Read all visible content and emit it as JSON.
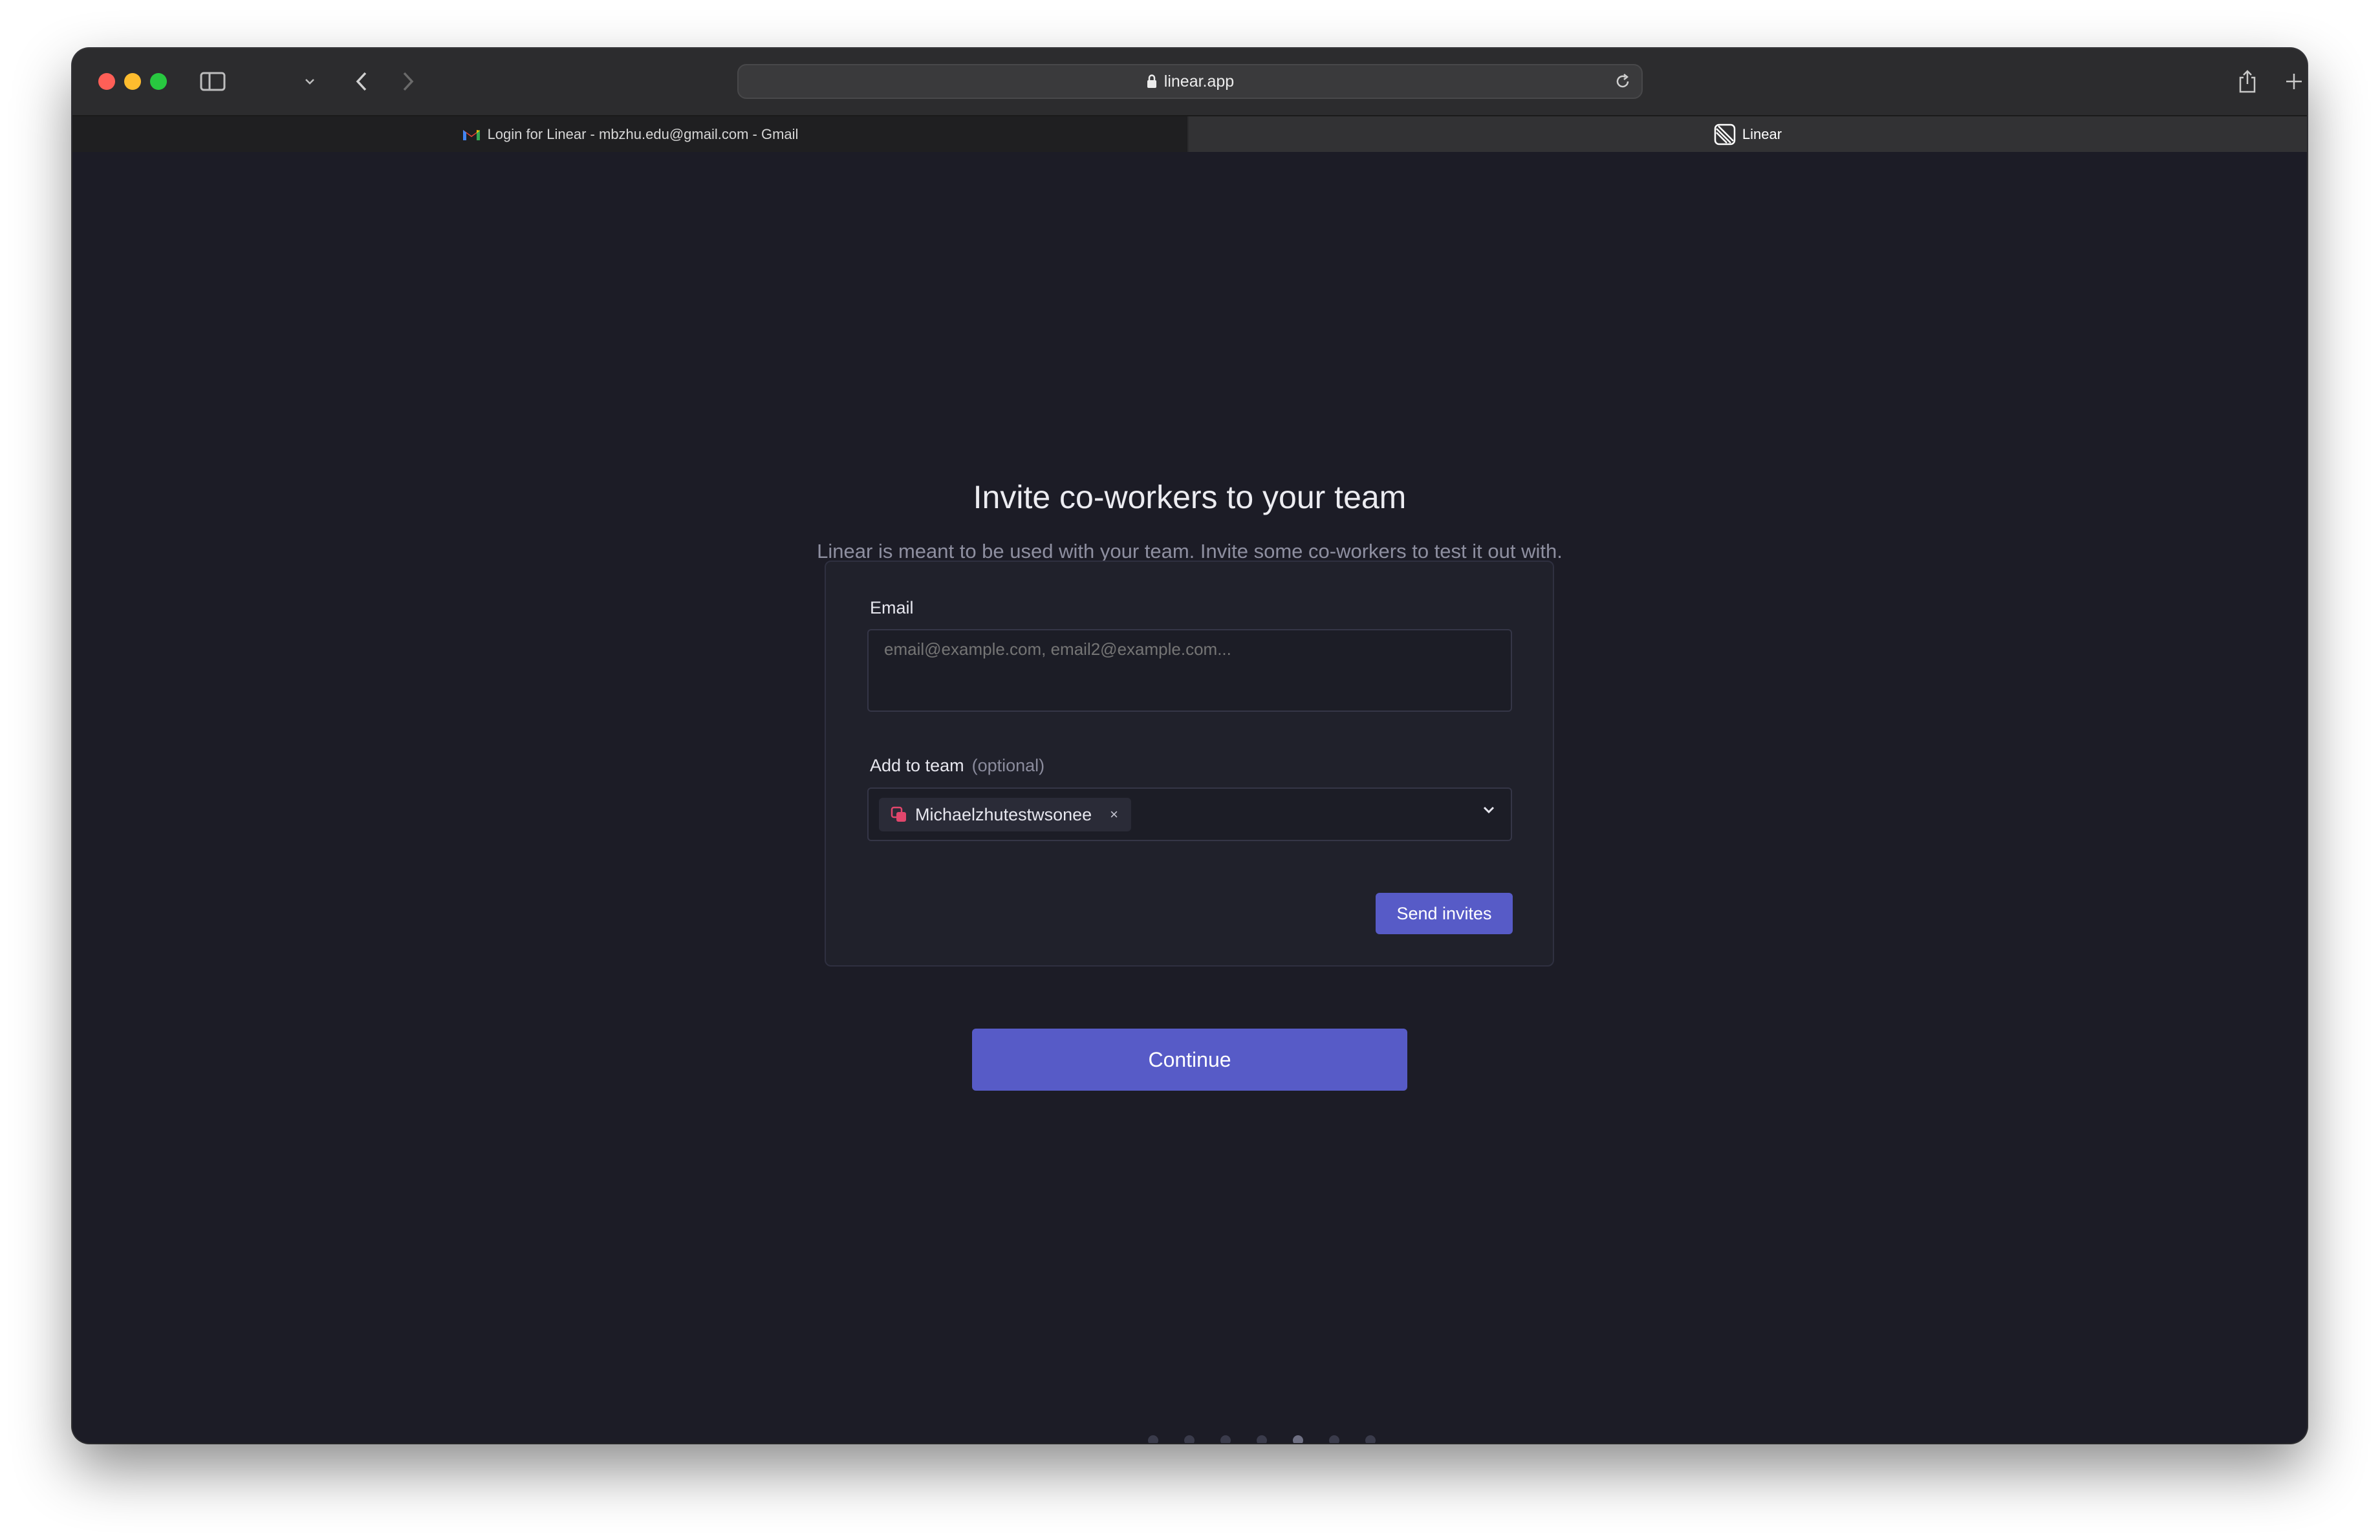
{
  "browser": {
    "url": "linear.app",
    "tabs": [
      {
        "label": "Login for Linear - mbzhu.edu@gmail.com - Gmail",
        "favicon": "gmail-icon",
        "active": false
      },
      {
        "label": "Linear",
        "favicon": "linear-logo-icon",
        "active": true
      }
    ]
  },
  "page": {
    "title": "Invite co-workers to your team",
    "subtitle": "Linear is meant to be used with your team. Invite some co-workers to test it out with.",
    "form": {
      "email_label": "Email",
      "email_placeholder": "email@example.com, email2@example.com...",
      "email_value": "",
      "team_label": "Add to team",
      "team_optional": "(optional)",
      "selected_team": "Michaelzhutestwsonee",
      "remove_symbol": "×",
      "send_label": "Send invites"
    },
    "continue_label": "Continue",
    "progress": {
      "total_steps": 7,
      "current_step": 5
    }
  },
  "colors": {
    "background": "#1c1c26",
    "card": "#20212b",
    "accent": "#575bc7",
    "team_icon": "#e2466c"
  }
}
